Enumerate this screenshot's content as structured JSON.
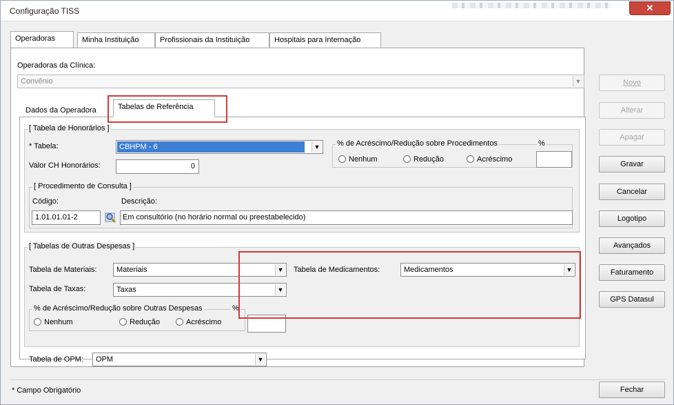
{
  "window": {
    "title": "Configuração TISS",
    "close_label": "✕"
  },
  "tabs_top": [
    "Operadoras",
    "Minha Instituição",
    "Profissionais da Instituição",
    "Hospitais para Internação"
  ],
  "operadoras": {
    "label": "Operadoras da Clínica:",
    "value": "Convênio"
  },
  "sub_tabs": [
    "Dados da Operadora",
    "Tabelas de Referência"
  ],
  "honorarios": {
    "group_title": "[ Tabela de Honorários ]",
    "tabela_label": "* Tabela:",
    "tabela_value": "CBHPM - 6",
    "valor_ch_label": "Valor CH Honorários:",
    "valor_ch_value": "0",
    "percent_group_title": "% de Acréscimo/Redução sobre Procedimentos",
    "percent_label": "%",
    "radio_nenhum": "Nenhum",
    "radio_reducao": "Redução",
    "radio_acrescimo": "Acréscimo"
  },
  "consulta": {
    "group_title": "[ Procedimento de Consulta ]",
    "codigo_label": "Código:",
    "codigo_value": "1.01.01.01-2",
    "descricao_label": "Descrição:",
    "descricao_value": "Em consultório (no horário normal ou preestabelecido)"
  },
  "outras": {
    "group_title": "[ Tabelas de Outras Despesas ]",
    "materiais_label": "Tabela de Materiais:",
    "materiais_value": "Materiais",
    "medicamentos_label": "Tabela de Medicamentos:",
    "medicamentos_value": "Medicamentos",
    "taxas_label": "Tabela de Taxas:",
    "taxas_value": "Taxas",
    "percent_group_title": "% de Acréscimo/Redução sobre Outras Despesas",
    "percent_label": "%",
    "radio_nenhum": "Nenhum",
    "radio_reducao": "Redução",
    "radio_acrescimo": "Acréscimo"
  },
  "opm": {
    "label": "Tabela de OPM:",
    "value": "OPM"
  },
  "buttons": {
    "novo": "Novo",
    "alterar": "Alterar",
    "apagar": "Apagar",
    "gravar": "Gravar",
    "cancelar": "Cancelar",
    "logotipo": "Logotipo",
    "avancados": "Avançados",
    "faturamento": "Faturamento",
    "gps": "GPS Datasul",
    "fechar": "Fechar"
  },
  "status": {
    "required_note": "* Campo Obrigatório"
  },
  "colors": {
    "highlight_box": "#d23a3a",
    "selection": "#3d7fd4"
  }
}
